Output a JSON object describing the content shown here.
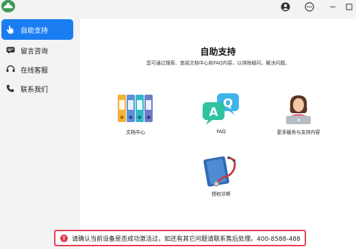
{
  "colors": {
    "accent": "#1a7df1",
    "notice_border": "#e23b52",
    "logo_green": "#3e9a56"
  },
  "titlebar": {
    "logo_icon": "app-logo-icon",
    "buttons": [
      {
        "name": "user-icon"
      },
      {
        "name": "more-icon"
      },
      {
        "name": "minimize-icon",
        "glyph": "—"
      },
      {
        "name": "maximize-icon",
        "glyph": "☐"
      }
    ]
  },
  "sidebar": {
    "items": [
      {
        "label": "自助支持",
        "icon": "hand-pointer-icon",
        "active": true
      },
      {
        "label": "留言咨询",
        "icon": "message-icon",
        "active": false
      },
      {
        "label": "在线客服",
        "icon": "headset-icon",
        "active": false
      },
      {
        "label": "联系我们",
        "icon": "phone-icon",
        "active": false
      }
    ]
  },
  "main": {
    "title": "自助支持",
    "subtitle": "您可通过搜索、查阅文档中心和FAQ内容，以排除疑问，解决问题。",
    "cards": [
      {
        "label": "文档中心",
        "icon": "binders-icon"
      },
      {
        "label": "FAQ",
        "icon": "qa-bubbles-icon"
      },
      {
        "label": "更多服务与支持内容",
        "icon": "support-agent-icon"
      },
      {
        "label": "授权诊断",
        "icon": "stethoscope-icon"
      }
    ]
  },
  "notice": {
    "icon": "warning-icon",
    "text": "请确认当前设备是否成功激活过，如还有其它问题请联系售后处理。400-8588-488"
  }
}
